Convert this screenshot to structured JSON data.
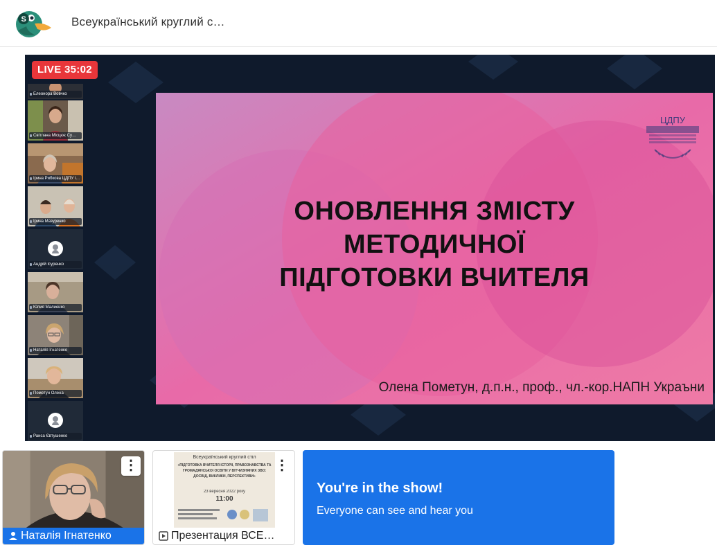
{
  "header": {
    "title": "Всеукраїнський круглий с…",
    "logo_icon": "duck-logo-icon"
  },
  "stage": {
    "live_label": "LIVE 35:02",
    "participants": [
      {
        "name": "Елеонора Вовчко",
        "kind": "video"
      },
      {
        "name": "Світлана Місцює Су…",
        "kind": "video"
      },
      {
        "name": "Ірина Рибкова ЦДПУ і…",
        "kind": "video"
      },
      {
        "name": "Ірина Мазуренко",
        "kind": "video"
      },
      {
        "name": "Андрій Ісуренко",
        "kind": "avatar"
      },
      {
        "name": "Юлия Малиенко",
        "kind": "video"
      },
      {
        "name": "Наталія Ігнатенко",
        "kind": "video"
      },
      {
        "name": "Пометун Олена",
        "kind": "video"
      },
      {
        "name": "Раиса Євтушенко",
        "kind": "avatar"
      }
    ],
    "slide": {
      "title_lines": [
        "ОНОВЛЕННЯ ЗМІСТУ",
        "МЕТОДИЧНОЇ",
        "ПІДГОТОВКИ ВЧИТЕЛЯ"
      ],
      "author": "Олена Пометун, д.п.н., проф., чл.-кор.НАПН Украъни",
      "logo_text": "ЦДПУ"
    }
  },
  "bottom": {
    "tile_person": {
      "name": "Наталія Ігнатенко",
      "menu_icon": "kebab-menu-icon",
      "icon": "person-icon"
    },
    "tile_presentation": {
      "name": "Презентация ВСЕ…",
      "menu_icon": "kebab-menu-icon",
      "icon": "play-box-icon",
      "poster": {
        "line1": "Всеукраїнський круглий стіл",
        "line2": "«ПІДГОТОВКА ВЧИТЕЛЯ ІСТОРІЇ, ПРАВОЗНАВСТВА ТА",
        "line3": "ГРОМАДЯНСЬКОЇ ОСВІТИ У ВІТЧИЗНЯНИХ ЗВО:",
        "line4": "ДОСВІД, ВИКЛИКИ, ПЕРСПЕКТИВИ»",
        "date": "23 вересня 2022 року",
        "time": "11:00"
      }
    },
    "show_card": {
      "title": "You're in the show!",
      "subtitle": "Everyone can see and hear you"
    }
  },
  "colors": {
    "accent": "#1a73e8",
    "live": "#e8363a",
    "stage_bg": "#0f1a2c",
    "slide_pink": "#dc6aa8"
  }
}
